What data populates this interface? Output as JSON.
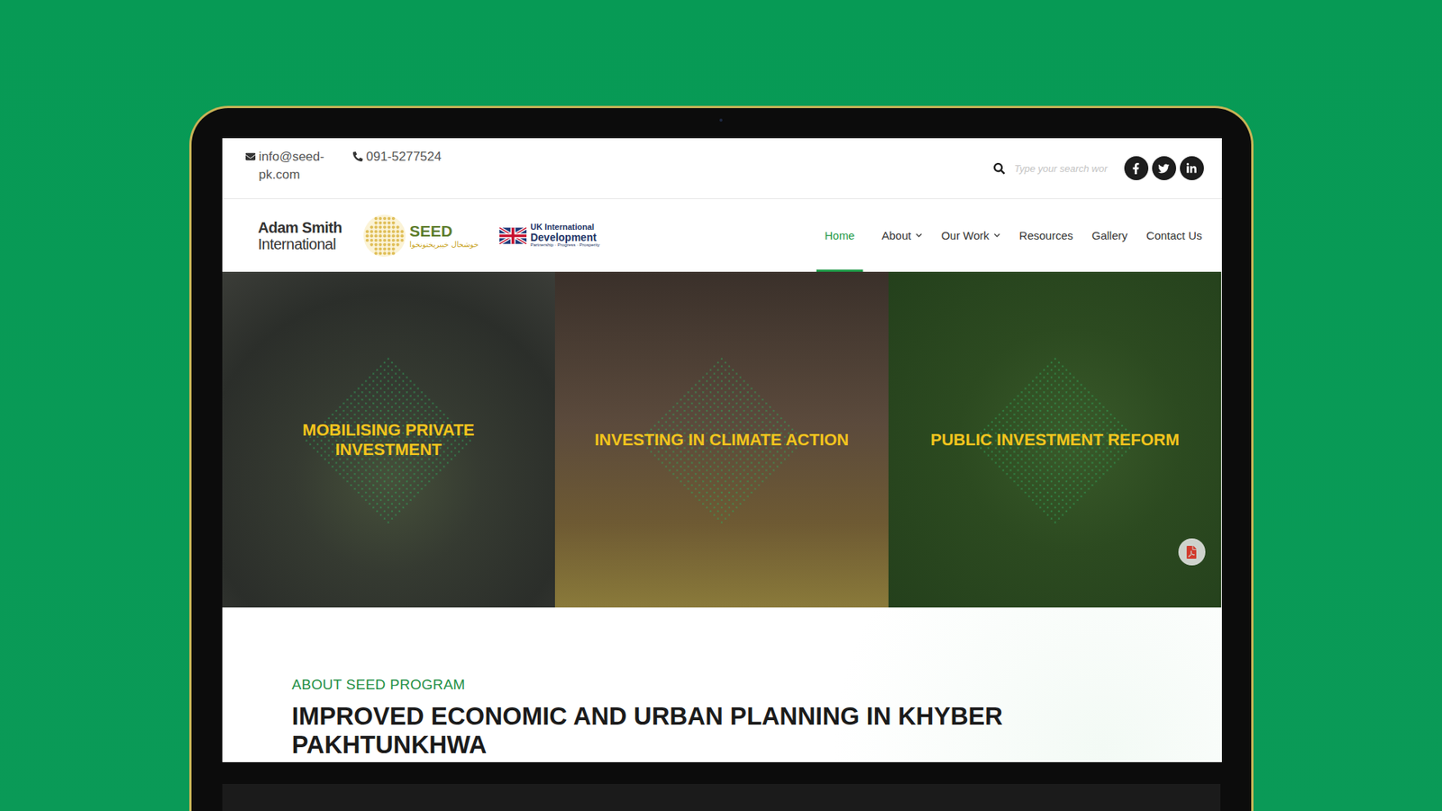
{
  "contact": {
    "email": "info@seed-pk.com",
    "phone": "091-5277524"
  },
  "search": {
    "placeholder": "Type your search wor"
  },
  "logos": {
    "adam_smith": {
      "line1": "Adam Smith",
      "line2": "International"
    },
    "seed": {
      "name": "SEED",
      "tagline": "خوشحال خیبرپختونخوا"
    },
    "uk": {
      "line1": "UK International",
      "line2": "Development",
      "tagline": "Partnership · Progress · Prosperity"
    }
  },
  "nav": [
    {
      "label": "Home",
      "selected": true,
      "dropdown": false
    },
    {
      "label": "About",
      "selected": false,
      "dropdown": true
    },
    {
      "label": "Our Work",
      "selected": false,
      "dropdown": true
    },
    {
      "label": "Resources",
      "selected": false,
      "dropdown": false
    },
    {
      "label": "Gallery",
      "selected": false,
      "dropdown": false
    },
    {
      "label": "Contact Us",
      "selected": false,
      "dropdown": false
    }
  ],
  "hero": [
    {
      "title": "MOBILISING PRIVATE INVESTMENT"
    },
    {
      "title": "INVESTING IN CLIMATE ACTION"
    },
    {
      "title": "PUBLIC INVESTMENT REFORM"
    }
  ],
  "about": {
    "label": "ABOUT SEED PROGRAM",
    "heading": "IMPROVED ECONOMIC AND URBAN PLANNING IN KHYBER PAKHTUNKHWA"
  }
}
